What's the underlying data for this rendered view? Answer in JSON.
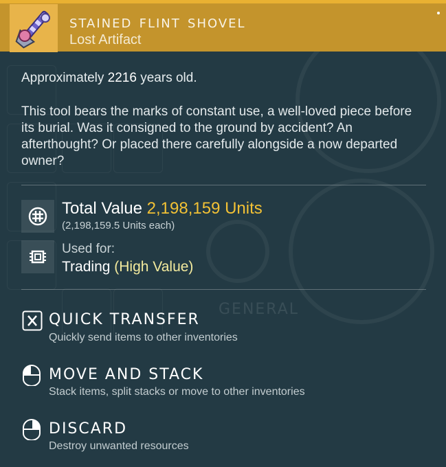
{
  "header": {
    "title": "STAINED FLINT SHOVEL",
    "subtitle": "Lost Artifact",
    "icon": "artifact-item-icon"
  },
  "colors": {
    "header_bg": "#c4942c",
    "accent_value": "#f2c135",
    "highlight": "#f4eb9e",
    "panel_bg": "#233a44"
  },
  "details": {
    "age_prefix": "Approximately ",
    "age_value": "2216",
    "age_suffix": " years old.",
    "description": "This tool bears the marks of constant use, a well-loved piece before its burial. Was it consigned to the ground by accident? An afterthought? Or placed there carefully alongside a now departed owner?"
  },
  "value": {
    "label": "Total Value ",
    "amount": "2,198,159 Units",
    "each": "(2,198,159.5 Units each)",
    "icon": "units-currency-icon"
  },
  "usage": {
    "label": "Used for:",
    "value": "Trading ",
    "highlight": "(High Value)",
    "icon": "chip-icon"
  },
  "actions": [
    {
      "key_icon": "x-key-icon",
      "title": "QUICK TRANSFER",
      "desc": "Quickly send items to other inventories"
    },
    {
      "key_icon": "mouse-left-icon",
      "title": "MOVE AND STACK",
      "desc": "Stack items, split stacks or move to other inventories"
    },
    {
      "key_icon": "mouse-right-icon",
      "title": "DISCARD",
      "desc": "Destroy unwanted resources"
    }
  ],
  "background": {
    "watermark": "GENERAL"
  }
}
